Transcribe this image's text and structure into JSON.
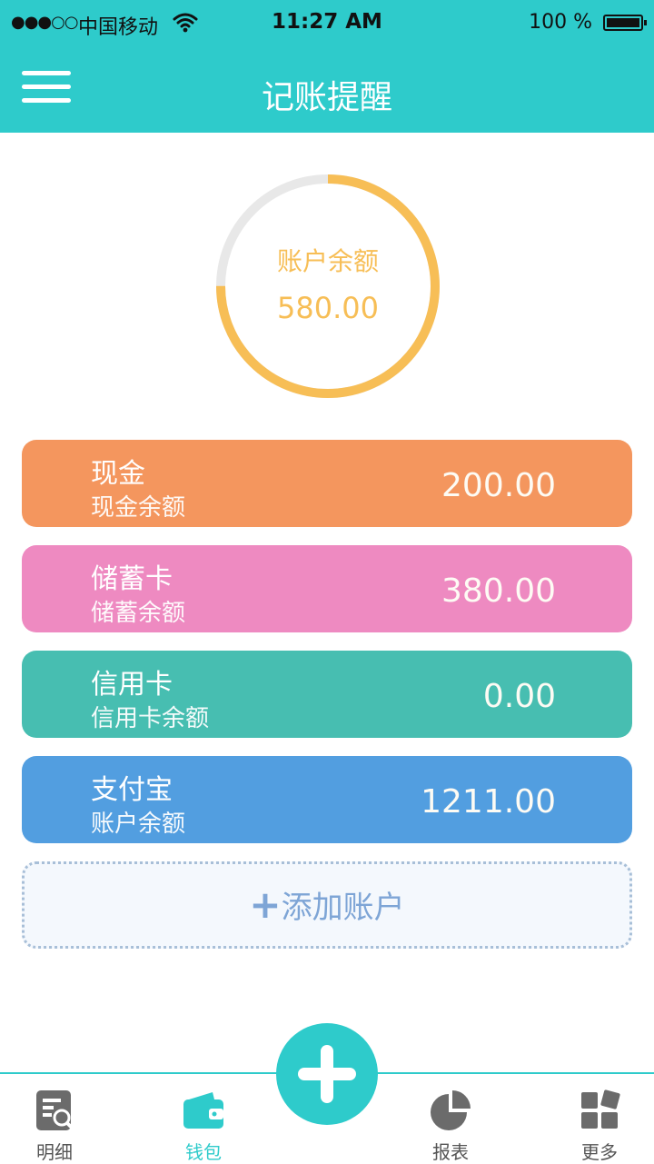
{
  "status_bar": {
    "signal": "●●●○○",
    "carrier": "中国移动",
    "time": "11:27 AM",
    "battery": "100 %"
  },
  "header": {
    "title": "记账提醒",
    "menu_icon": "hamburger-menu-icon"
  },
  "balance": {
    "label": "账户余额",
    "value": "580.00",
    "ring_fill_fraction": 0.75,
    "ring_color": "#f7be56",
    "ring_track_color": "#e8e8e8"
  },
  "accounts": [
    {
      "name": "现金",
      "subtitle": "现金余额",
      "amount": "200.00",
      "color": "#f4965e"
    },
    {
      "name": "储蓄卡",
      "subtitle": "储蓄余额",
      "amount": "380.00",
      "color": "#ee8ac1"
    },
    {
      "name": "信用卡",
      "subtitle": "信用卡余额",
      "amount": "0.00",
      "color": "#47beb1"
    },
    {
      "name": "支付宝",
      "subtitle": "账户余额",
      "amount": "1211.00",
      "color": "#529ee0"
    }
  ],
  "add_account": {
    "plus": "+",
    "label": "添加账户"
  },
  "tabs": [
    {
      "label": "明细",
      "icon": "detail-search-icon"
    },
    {
      "label": "钱包",
      "icon": "wallet-icon"
    },
    {
      "label": "报表",
      "icon": "pie-chart-icon"
    },
    {
      "label": "更多",
      "icon": "grid-more-icon"
    }
  ],
  "active_tab": "钱包",
  "colors": {
    "brand": "#2ecbcb",
    "tab_inactive": "#555555"
  }
}
